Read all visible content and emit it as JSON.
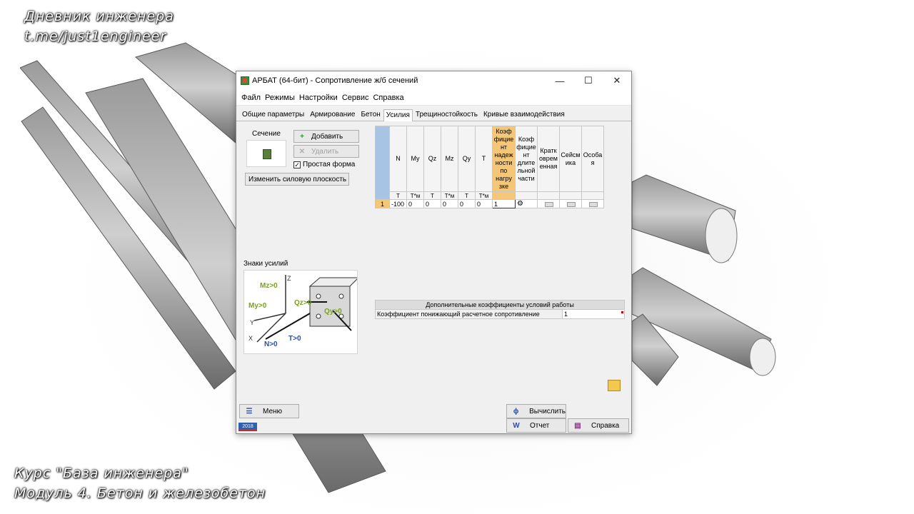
{
  "watermark": {
    "top_line1": "Дневник инженера",
    "top_line2": "t.me/just1engineer",
    "bottom_line1": "Курс \"База инженера\"",
    "bottom_line2": "Модуль 4. Бетон и железобетон"
  },
  "window": {
    "title": "АРБАТ (64-бит) - Сопротивление ж/б сечений",
    "controls": {
      "minimize": "—",
      "maximize": "☐",
      "close": "✕"
    },
    "menu": [
      "Файл",
      "Режимы",
      "Настройки",
      "Сервис",
      "Справка"
    ],
    "tabs": [
      "Общие параметры",
      "Армирование",
      "Бетон",
      "Усилия",
      "Трещиностойкость",
      "Кривые взаимодействия"
    ],
    "active_tab": "Усилия"
  },
  "left_panel": {
    "section_label": "Сечение",
    "add_button": "Добавить",
    "delete_button": "Удалить",
    "simple_shape_checkbox": {
      "label": "Простая форма",
      "checked": true
    },
    "change_plane_button": "Изменить силовую плоскость",
    "signs_label": "Знаки усилий",
    "signs_diagram": {
      "mz": "Mz>0",
      "my": "My>0",
      "qz": "Qz>0",
      "qy": "Qy>0",
      "n": "N>0",
      "t": "T>0",
      "axis_z": "Z",
      "axis_y": "Y",
      "axis_x": "X"
    }
  },
  "loads_grid": {
    "columns": [
      {
        "header": "N",
        "unit": "T"
      },
      {
        "header": "My",
        "unit": "T*м"
      },
      {
        "header": "Qz",
        "unit": "T"
      },
      {
        "header": "Mz",
        "unit": "T*м"
      },
      {
        "header": "Qy",
        "unit": "T"
      },
      {
        "header": "T",
        "unit": "T*м"
      },
      {
        "header": "Коэф фицие нт надеж ности по нагру зке",
        "unit": ""
      },
      {
        "header": "Коэф фицие нт длите льной части",
        "unit": ""
      },
      {
        "header": "Кратк оврем енная",
        "unit": ""
      },
      {
        "header": "Сейсм ика",
        "unit": ""
      },
      {
        "header": "Особа я",
        "unit": ""
      }
    ],
    "rows": [
      {
        "num": "1",
        "values": [
          "-100",
          "0",
          "0",
          "0",
          "0",
          "0",
          "1"
        ]
      }
    ]
  },
  "coefficients": {
    "header": "Дополнительные коэффициенты условий работы",
    "rows": [
      {
        "label": "Коэффициент понижающий расчетное сопротивление",
        "value": "1"
      }
    ]
  },
  "footer": {
    "menu_button": "Меню",
    "calculate_button": "Вычислить",
    "report_button": "Отчет",
    "help_button": "Справка",
    "year_badge": "2018"
  }
}
